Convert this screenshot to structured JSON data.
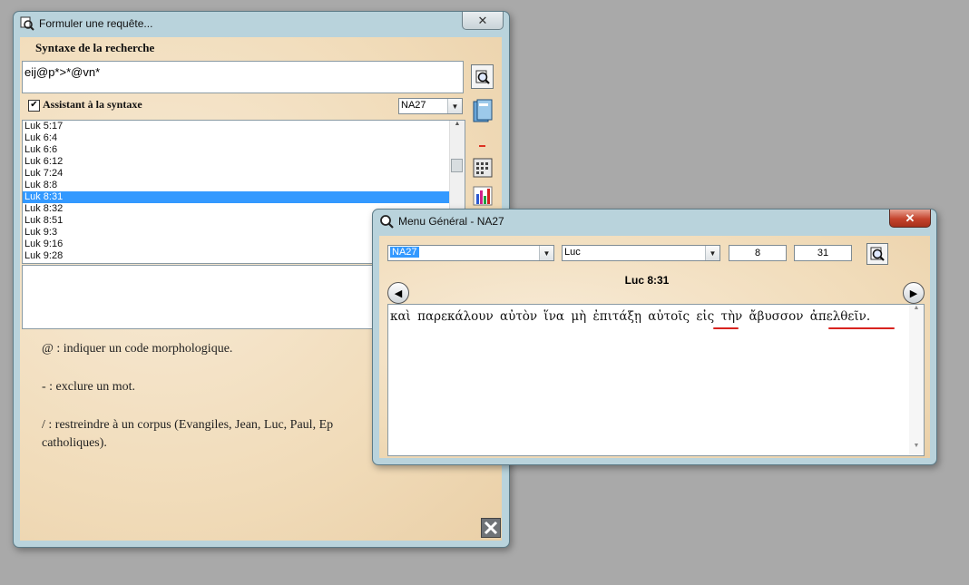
{
  "query_window": {
    "title": "Formuler une requête...",
    "close_label": "✕",
    "syntax_heading": "Syntaxe de la recherche",
    "query_value": "eij@p*>*@vn*",
    "assistant_label": "Assistant à la syntaxe",
    "assistant_checked": true,
    "version_select": "NA27",
    "references": [
      "Luk 5:17",
      "Luk 6:4",
      "Luk 6:6",
      "Luk 6:12",
      "Luk 7:24",
      "Luk 8:8",
      "Luk 8:31",
      "Luk 8:32",
      "Luk 8:51",
      "Luk 9:3",
      "Luk 9:16",
      "Luk 9:28"
    ],
    "selected_reference": "Luk 8:31",
    "help_lines": [
      "@ : indiquer un code morphologique.",
      "- : exclure un mot.",
      "/ : restreindre à un corpus (Evangiles, Jean, Luc, Paul, Ep",
      "catholiques)."
    ],
    "cancel_icon": "x-cancel-icon"
  },
  "menu_window": {
    "title": "Menu Général - NA27",
    "close_label": "✕",
    "version_value": "NA27",
    "book_value": "Luc",
    "chapter_value": "8",
    "verse_value": "31",
    "reference_heading": "Luc 8:31",
    "verse_text": "καὶ παρεκάλουν αὐτὸν ἵνα μὴ ἐπιτάξῃ αὐτοῖς εἰς τὴν ἄβυσσον ἀπελθεῖν."
  }
}
